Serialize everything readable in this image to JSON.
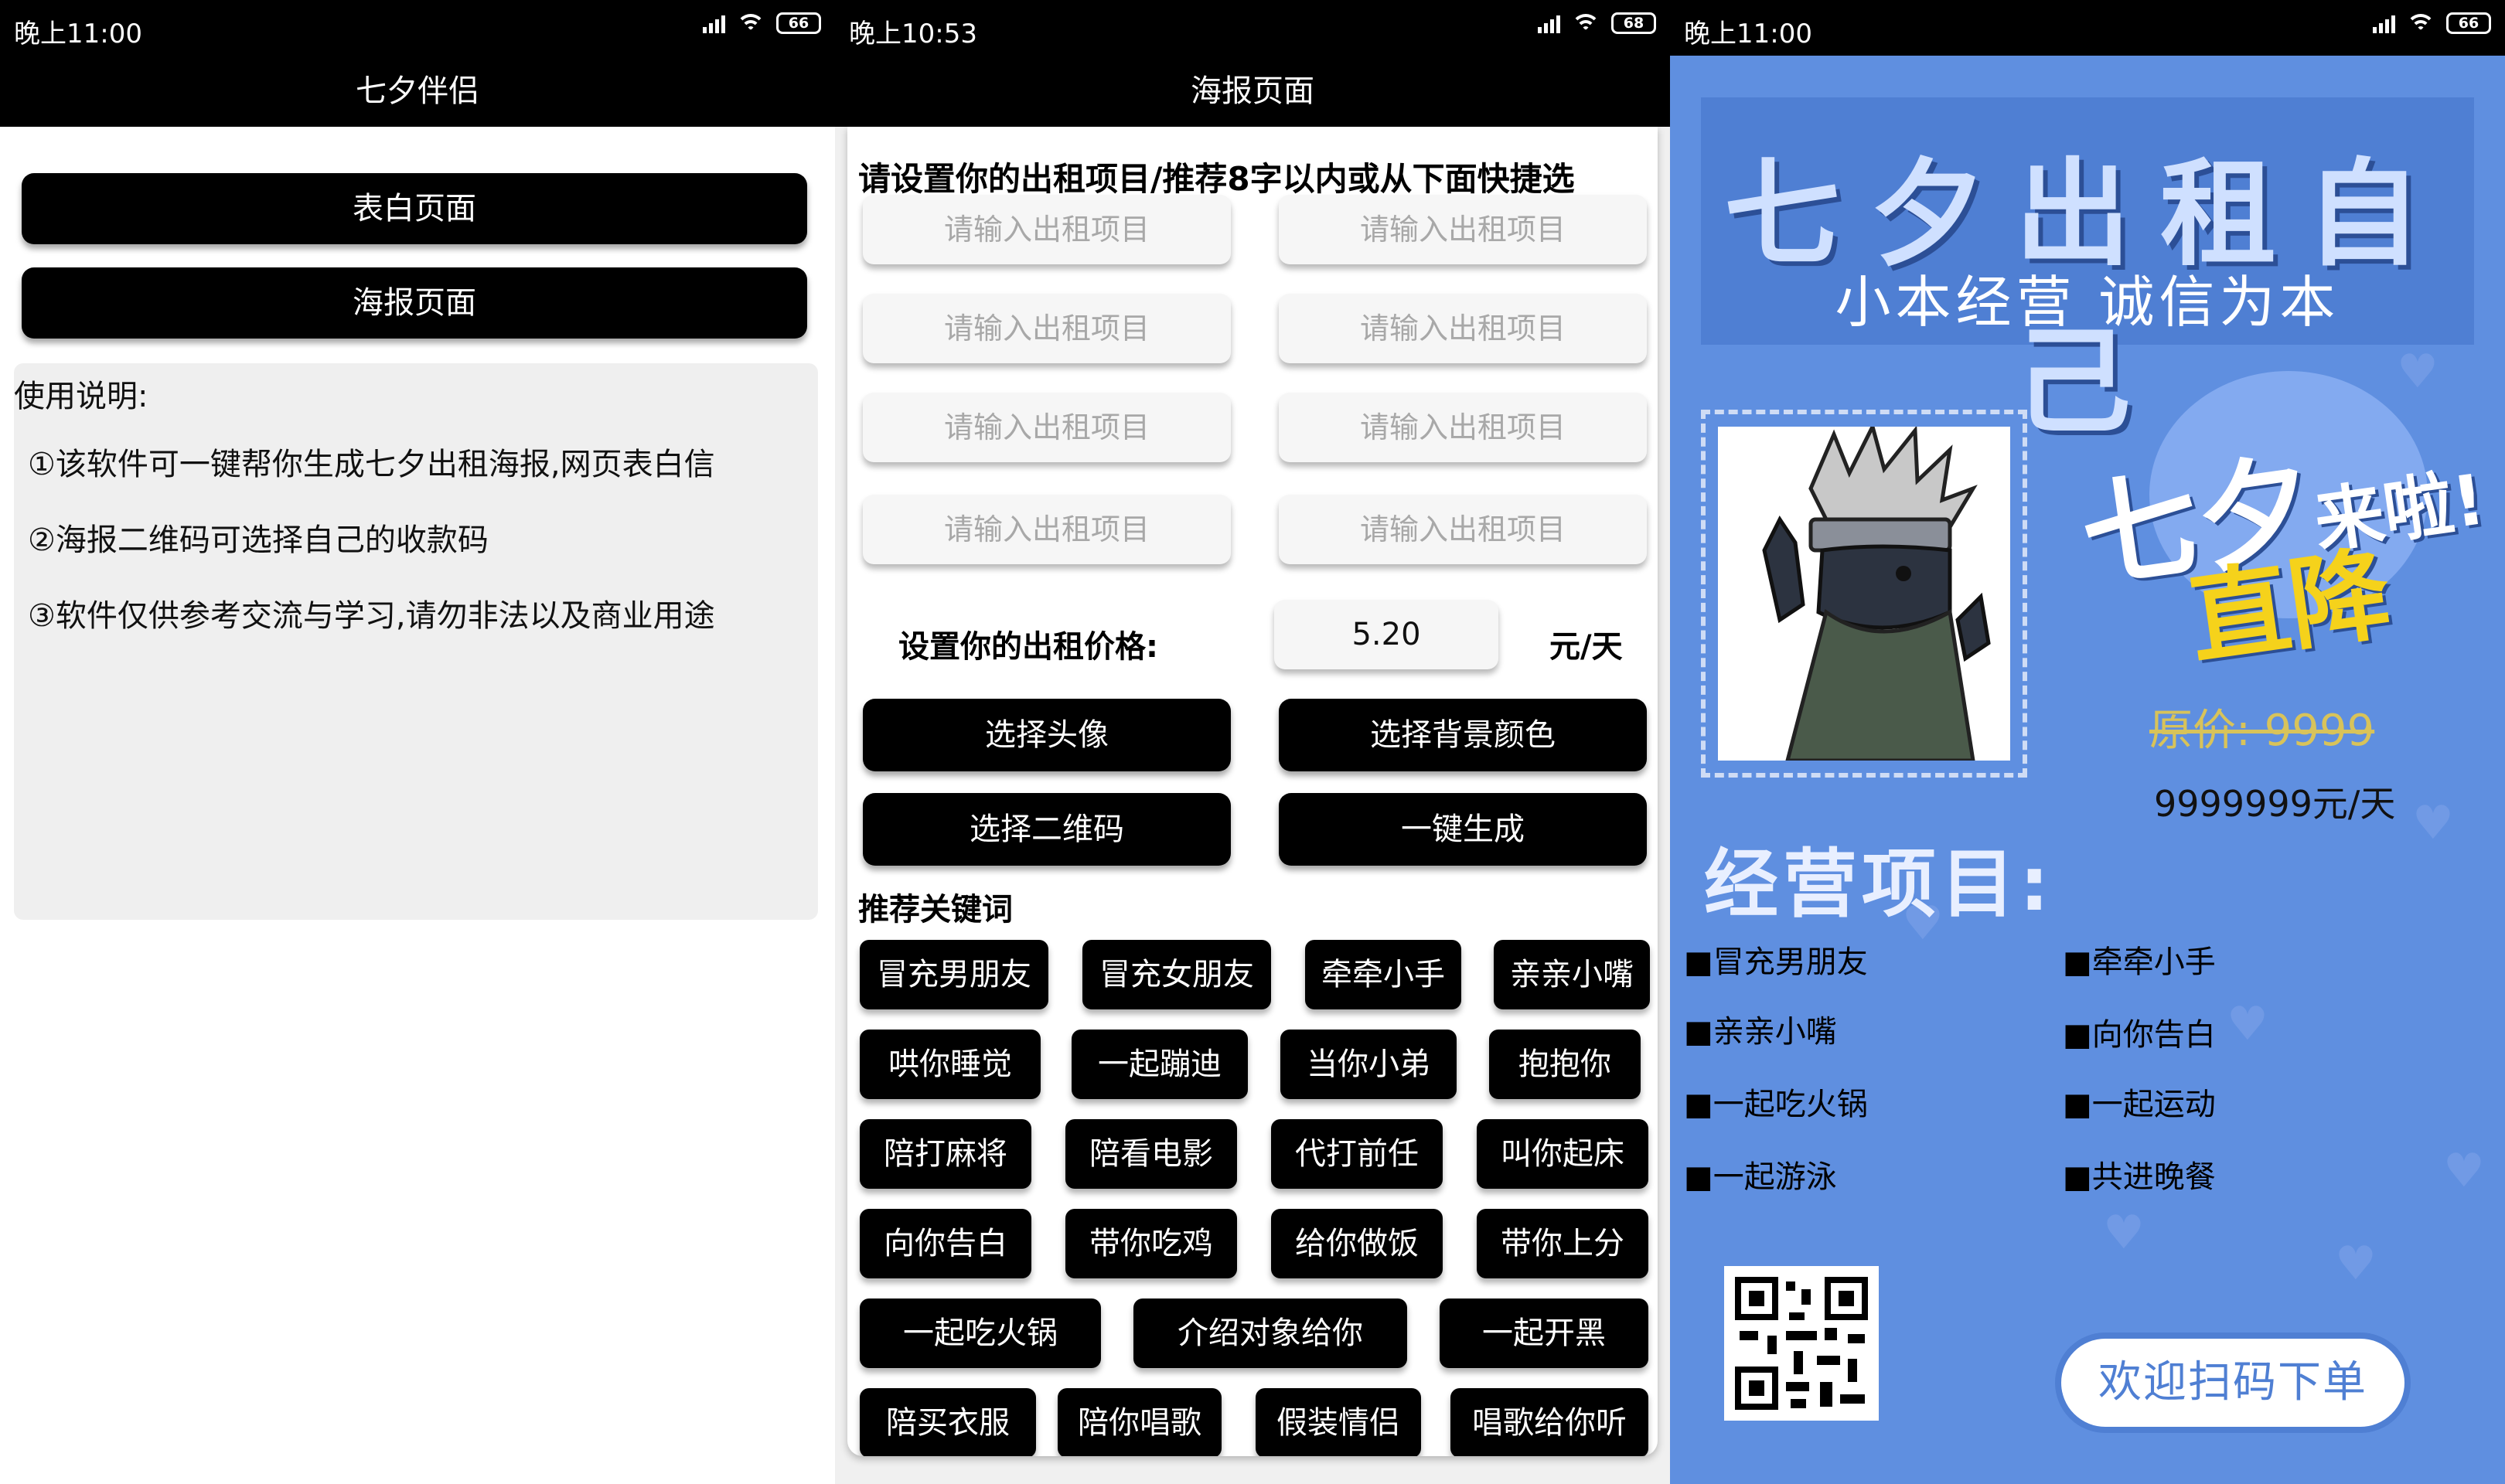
{
  "left_screen": {
    "status": {
      "time": "晚上11:00",
      "battery": "66"
    },
    "title": "七夕伴侣",
    "buttons": [
      "表白页面",
      "海报页面"
    ],
    "usage": {
      "title": "使用说明:",
      "lines": [
        "①该软件可一键帮你生成七夕出租海报,网页表白信",
        "②海报二维码可选择自己的收款码",
        "③软件仅供参考交流与学习,请勿非法以及商业用途"
      ]
    }
  },
  "middle_screen": {
    "status": {
      "time": "晚上10:53",
      "battery": "68"
    },
    "title": "海报页面",
    "hint": "请设置你的出租项目/推荐8字以内或从下面快捷选",
    "input_placeholder": "请输入出租项目",
    "price_label": "设置你的出租价格:",
    "price_value": "5.20",
    "price_unit": "元/天",
    "actions": [
      "选择头像",
      "选择背景颜色",
      "选择二维码",
      "一键生成"
    ],
    "keywords_title": "推荐关键词",
    "keywords": [
      "冒充男朋友",
      "冒充女朋友",
      "牵牵小手",
      "亲亲小嘴",
      "哄你睡觉",
      "一起蹦迪",
      "当你小弟",
      "抱抱你",
      "陪打麻将",
      "陪看电影",
      "代打前任",
      "叫你起床",
      "向你告白",
      "带你吃鸡",
      "给你做饭",
      "带你上分",
      "一起吃火锅",
      "介绍对象给你",
      "一起开黑",
      "陪买衣服",
      "陪你唱歌",
      "假装情侣",
      "唱歌给你听"
    ]
  },
  "right_screen": {
    "status": {
      "time": "晚上11:00",
      "battery": "66"
    },
    "headline": "七夕出租自己",
    "subline": "小本经营 诚信为本",
    "promo_1": "七夕",
    "promo_1b": "来啦!",
    "promo_2": "直降",
    "original_price": "原价: 9999",
    "price": "9999999元/天",
    "services_title": "经营项目:",
    "services": [
      "■冒充男朋友",
      "■牵牵小手",
      "■亲亲小嘴",
      "■向你告白",
      "■一起吃火锅",
      "■一起运动",
      "■一起游泳",
      "■共进晚餐"
    ],
    "scan_label": "欢迎扫码下单"
  },
  "colors": {
    "poster_bg": "#5f8fe0",
    "poster_header": "#4f7fd3",
    "promo_yellow": "#f5d21b",
    "black": "#000000"
  }
}
